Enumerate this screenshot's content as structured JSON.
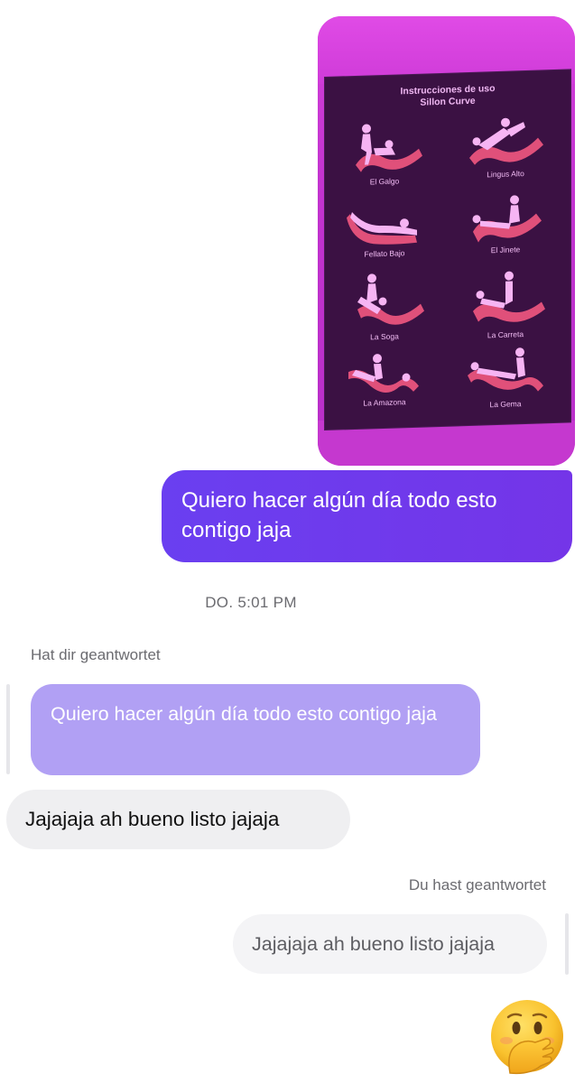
{
  "photo": {
    "alt": "instructions-poster-photo",
    "title_line1": "Instrucciones de uso",
    "title_line2": "Sillon Curve",
    "positions": [
      "El Galgo",
      "Lingus Alto",
      "Fellato Bajo",
      "El Jinete",
      "La Soga",
      "La Carreta",
      "La Amazona",
      "La Gema"
    ]
  },
  "messages": {
    "sent_text": "Quiero hacer algún día todo esto contigo jaja",
    "timestamp": "DO. 5:01 PM",
    "reply_label_left": "Hat dir geantwortet",
    "quoted_sent_text": "Quiero hacer algún día todo esto contigo jaja",
    "received_text": "Jajajaja ah bueno listo jajaja",
    "reply_label_right": "Du hast geantwortet",
    "quoted_received_text": "Jajajaja ah bueno listo jajaja"
  },
  "emoji": {
    "name": "face-with-hand-over-mouth-icon"
  },
  "colors": {
    "sent_bubble": "#7435e8",
    "quoted_sent_bubble": "#b1a0f4",
    "received_bubble": "#efeff1",
    "photo_wall": "#c233cf",
    "poster_bg": "#3b1143",
    "chair_red": "#e0507a",
    "figure_pink": "#f6b4f3"
  }
}
